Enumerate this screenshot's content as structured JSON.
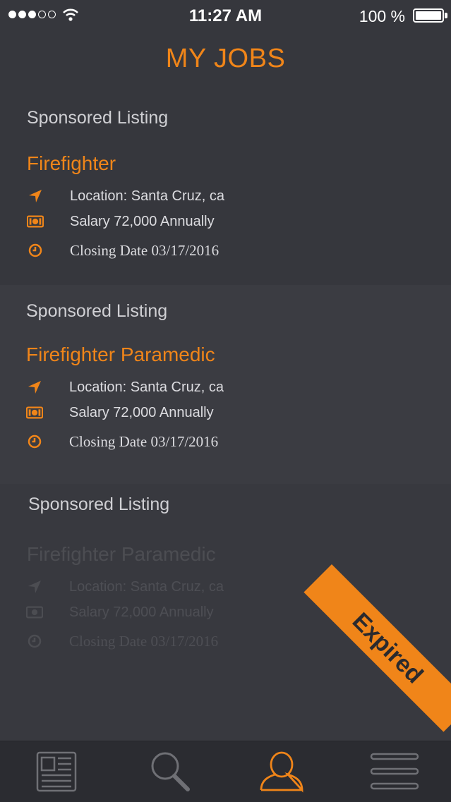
{
  "status": {
    "time": "11:27 AM",
    "battery": "100 %"
  },
  "header": {
    "title": "MY JOBS"
  },
  "listings": [
    {
      "sponsored": "Sponsored Listing",
      "title": "Firefighter",
      "location": "Location: Santa Cruz, ca",
      "salary": "Salary 72,000 Annually",
      "closing": "Closing Date 03/17/2016"
    },
    {
      "sponsored": "Sponsored Listing",
      "title": "Firefighter Paramedic",
      "location": "Location: Santa Cruz, ca",
      "salary": "Salary 72,000 Annually",
      "closing": "Closing Date 03/17/2016"
    },
    {
      "sponsored": "Sponsored Listing",
      "title": "Firefighter Paramedic",
      "location": "Location: Santa Cruz, ca",
      "salary": "Salary 72,000 Annually",
      "closing": "Closing Date 03/17/2016",
      "badge": "Expired"
    }
  ],
  "tabs": [
    {
      "icon": "news-icon",
      "active": false
    },
    {
      "icon": "search-icon",
      "active": false
    },
    {
      "icon": "profile-icon",
      "active": true
    },
    {
      "icon": "menu-icon",
      "active": false
    }
  ],
  "colors": {
    "accent": "#f08519",
    "background": "#36373d",
    "tabbar": "#2b2c31"
  }
}
